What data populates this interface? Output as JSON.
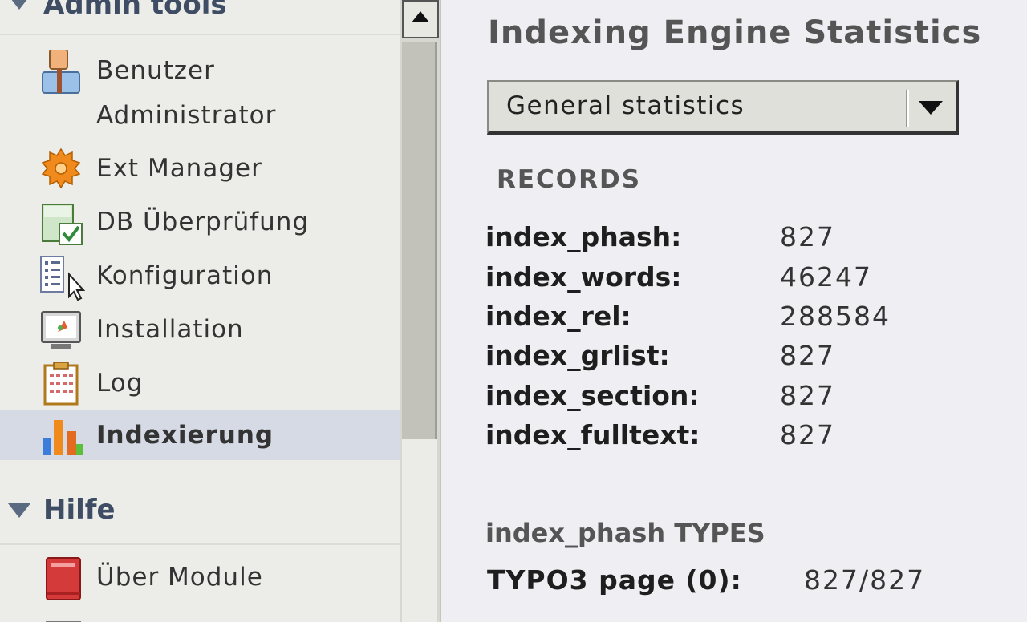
{
  "sidebar": {
    "admin_section_label": "Admin tools",
    "items": [
      {
        "label": "Benutzer",
        "label2": "Administrator",
        "icon": "user-admin-icon"
      },
      {
        "label": "Ext Manager",
        "icon": "ext-manager-gear-icon"
      },
      {
        "label": "DB Überprüfung",
        "icon": "db-check-icon"
      },
      {
        "label": "Konfiguration",
        "icon": "configuration-list-icon"
      },
      {
        "label": "Installation",
        "icon": "installation-monitor-icon"
      },
      {
        "label": "Log",
        "icon": "log-clipboard-icon"
      },
      {
        "label": "Indexierung",
        "icon": "bar-chart-icon",
        "selected": true
      }
    ],
    "help_section_label": "Hilfe",
    "help_items": [
      {
        "label": "Über Module",
        "icon": "book-icon"
      }
    ]
  },
  "main": {
    "title": "Indexing Engine Statistics",
    "select_value": "General statistics",
    "records_heading": "RECORDS",
    "records": [
      {
        "key": "index_phash:",
        "value": "827"
      },
      {
        "key": "index_words:",
        "value": "46247"
      },
      {
        "key": "index_rel:",
        "value": "288584"
      },
      {
        "key": "index_grlist:",
        "value": "827"
      },
      {
        "key": "index_section:",
        "value": "827"
      },
      {
        "key": "index_fulltext:",
        "value": "827"
      }
    ],
    "types_heading": "index_phash TYPES",
    "types": [
      {
        "key": "TYPO3 page (0):",
        "value": "827/827"
      }
    ]
  },
  "colors": {
    "sidebar_bg": "#ecece8",
    "selected_bg": "#d5dae4",
    "section_header": "#3e4d63",
    "main_bg": "#efeef2"
  }
}
